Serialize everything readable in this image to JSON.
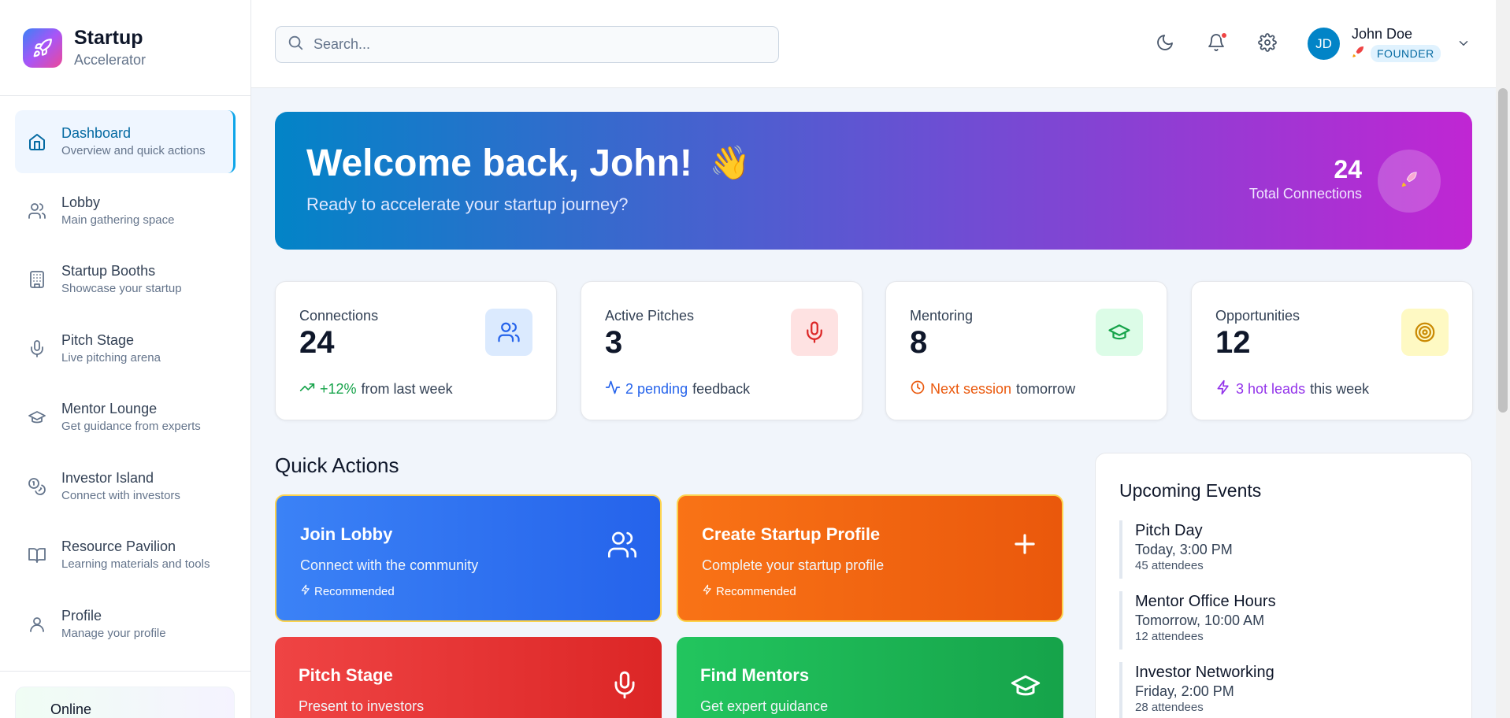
{
  "brand": {
    "title": "Startup",
    "subtitle": "Accelerator"
  },
  "nav": [
    {
      "label": "Dashboard",
      "desc": "Overview and quick actions",
      "icon": "home-icon"
    },
    {
      "label": "Lobby",
      "desc": "Main gathering space",
      "icon": "users-icon"
    },
    {
      "label": "Startup Booths",
      "desc": "Showcase your startup",
      "icon": "building-icon"
    },
    {
      "label": "Pitch Stage",
      "desc": "Live pitching arena",
      "icon": "microphone-icon"
    },
    {
      "label": "Mentor Lounge",
      "desc": "Get guidance from experts",
      "icon": "graduation-cap-icon"
    },
    {
      "label": "Investor Island",
      "desc": "Connect with investors",
      "icon": "coins-icon"
    },
    {
      "label": "Resource Pavilion",
      "desc": "Learning materials and tools",
      "icon": "book-icon"
    },
    {
      "label": "Profile",
      "desc": "Manage your profile",
      "icon": "user-icon"
    }
  ],
  "status": {
    "label": "Online"
  },
  "search": {
    "placeholder": "Search..."
  },
  "user": {
    "initials": "JD",
    "name": "John Doe",
    "role": "FOUNDER"
  },
  "banner": {
    "title": "Welcome back, John!",
    "emoji": "👋",
    "subtitle": "Ready to accelerate your startup journey?",
    "count": "24",
    "count_label": "Total Connections"
  },
  "stats": [
    {
      "label": "Connections",
      "value": "24",
      "highlight": "+12%",
      "rest": "from last week",
      "color": "#16a34a",
      "icon": "users-icon"
    },
    {
      "label": "Active Pitches",
      "value": "3",
      "highlight": "2 pending",
      "rest": "feedback",
      "color": "#2563eb",
      "icon": "microphone-icon"
    },
    {
      "label": "Mentoring",
      "value": "8",
      "highlight": "Next session",
      "rest": "tomorrow",
      "color": "#ea580c",
      "icon": "graduation-cap-icon"
    },
    {
      "label": "Opportunities",
      "value": "12",
      "highlight": "3 hot leads",
      "rest": "this week",
      "color": "#9333ea",
      "icon": "target-icon"
    }
  ],
  "quick_actions": {
    "title": "Quick Actions",
    "items": [
      {
        "title": "Join Lobby",
        "desc": "Connect with the community",
        "badge": "Recommended"
      },
      {
        "title": "Create Startup Profile",
        "desc": "Complete your startup profile",
        "badge": "Recommended"
      },
      {
        "title": "Pitch Stage",
        "desc": "Present to investors"
      },
      {
        "title": "Find Mentors",
        "desc": "Get expert guidance"
      }
    ]
  },
  "events": {
    "title": "Upcoming Events",
    "items": [
      {
        "name": "Pitch Day",
        "time": "Today, 3:00 PM",
        "attendees": "45 attendees"
      },
      {
        "name": "Mentor Office Hours",
        "time": "Tomorrow, 10:00 AM",
        "attendees": "12 attendees"
      },
      {
        "name": "Investor Networking",
        "time": "Friday, 2:00 PM",
        "attendees": "28 attendees"
      }
    ]
  }
}
